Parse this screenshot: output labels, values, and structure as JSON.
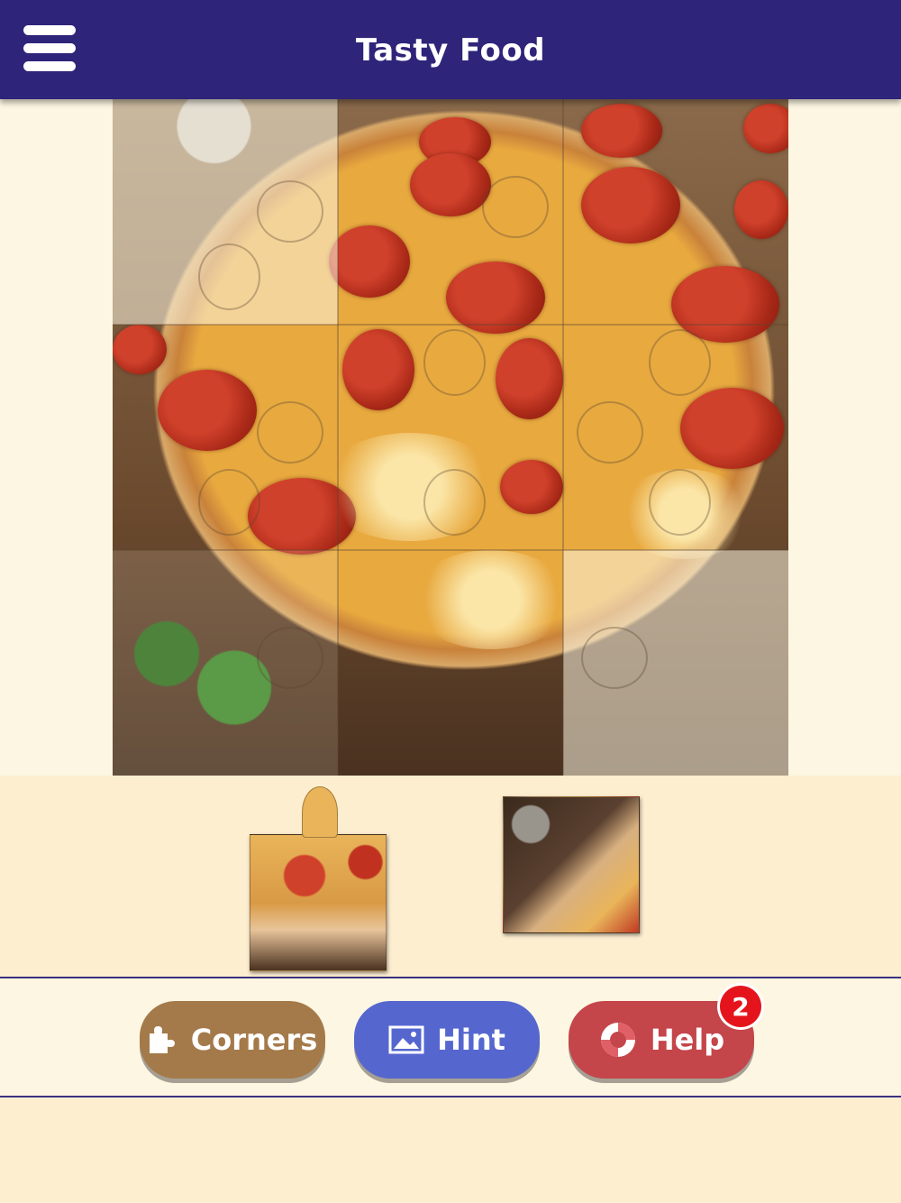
{
  "header": {
    "title": "Tasty Food",
    "menu_icon": "hamburger-menu-icon"
  },
  "puzzle": {
    "image_subject": "pepperoni pizza",
    "grid_rows": 3,
    "grid_cols": 3,
    "placed_pieces": 7,
    "loose_pieces": 2
  },
  "buttons": {
    "corners_label": "Corners",
    "corners_icon": "puzzle-corner-icon",
    "hint_label": "Hint",
    "hint_icon": "image-icon",
    "help_label": "Help",
    "help_icon": "lifebuoy-icon",
    "help_badge": "2"
  },
  "colors": {
    "header": "#2e2479",
    "corners_button": "#a47a4a",
    "hint_button": "#5567cf",
    "help_button": "#c4454a",
    "badge": "#e5141c"
  }
}
